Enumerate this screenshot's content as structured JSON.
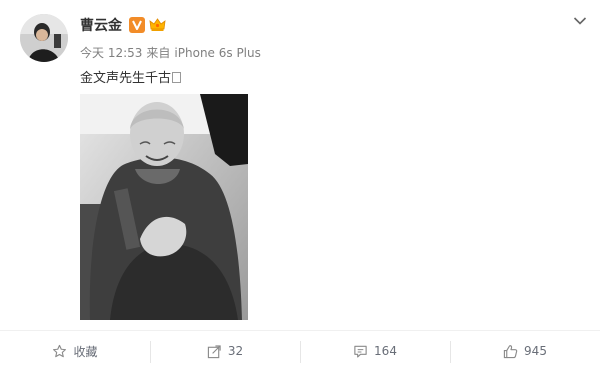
{
  "post": {
    "author": {
      "name": "曹云金",
      "verified_badge": "verified-v-icon",
      "vip_badge": "crown-icon"
    },
    "meta": {
      "time": "今天 12:53",
      "via": "来自",
      "device": "iPhone 6s Plus"
    },
    "text": "金文声先生千古",
    "image": {
      "description_icon": "portrait-photo"
    }
  },
  "actions": [
    {
      "icon": "star-icon",
      "label": "收藏"
    },
    {
      "icon": "share-icon",
      "label": "32"
    },
    {
      "icon": "comment-icon",
      "label": "164"
    },
    {
      "icon": "thumbs-up-icon",
      "label": "945"
    }
  ],
  "colors": {
    "accent_orange": "#f28c28",
    "meta_gray": "#808080",
    "action_gray": "#696e78"
  }
}
